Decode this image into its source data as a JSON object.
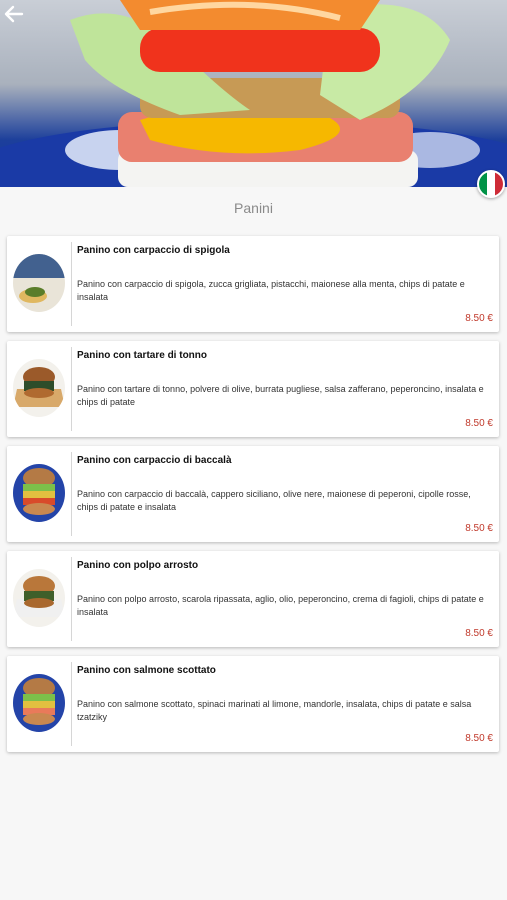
{
  "header": {
    "back_icon": "arrow-left-icon",
    "language_flag": "italian-flag-icon",
    "flag_colors": [
      "#009246",
      "#ffffff",
      "#ce2b37"
    ]
  },
  "section": {
    "title": "Panini"
  },
  "items": [
    {
      "title": "Panino con carpaccio di spigola",
      "description": "Panino con carpaccio di spigola, zucca grigliata, pistacchi, maionese alla menta, chips di patate e insalata",
      "price": "8.50 €"
    },
    {
      "title": "Panino con tartare di tonno",
      "description": "Panino con tartare di tonno, polvere di olive, burrata pugliese, salsa zafferano, peperoncino, insalata e chips di patate",
      "price": "8.50 €"
    },
    {
      "title": "Panino con carpaccio di baccalà",
      "description": "Panino con carpaccio di baccalà, cappero siciliano, olive nere, maionese di peperoni, cipolle rosse, chips di patate e insalata",
      "price": "8.50 €"
    },
    {
      "title": "Panino con polpo arrosto",
      "description": "Panino con polpo arrosto, scarola ripassata, aglio, olio, peperoncino, crema di fagioli, chips di patate e insalata",
      "price": "8.50 €"
    },
    {
      "title": "Panino con salmone scottato",
      "description": "Panino con salmone scottato, spinaci marinati al limone, mandorle, insalata, chips di patate e salsa tzatziky",
      "price": "8.50 €"
    }
  ],
  "colors": {
    "price": "#c0392b",
    "background": "#f7f7f7"
  }
}
